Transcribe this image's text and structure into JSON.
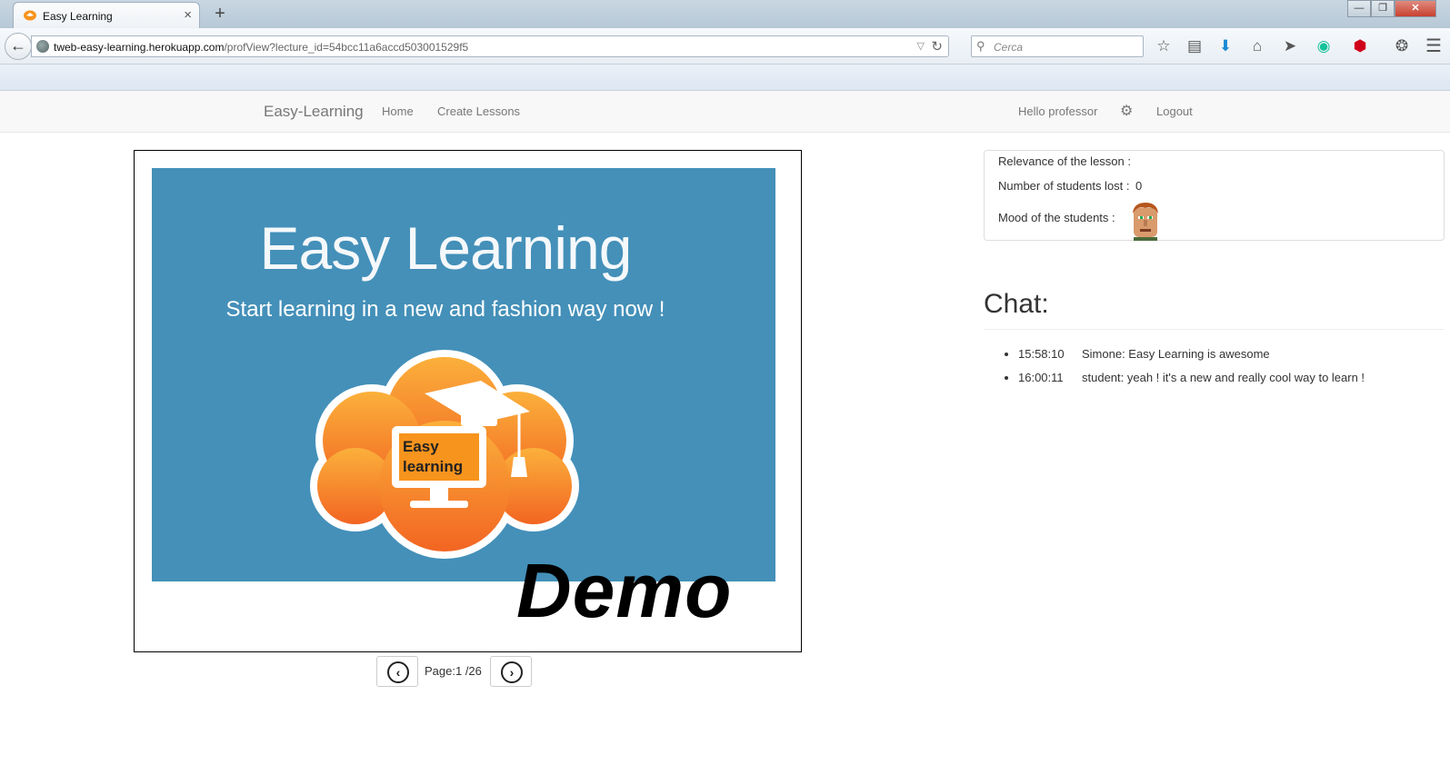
{
  "browser": {
    "tab_title": "Easy Learning",
    "tab_close": "×",
    "new_tab": "+",
    "url_host": "tweb-easy-learning.herokuapp.com",
    "url_path": "/profView?lecture_id=54bcc11a6accd503001529f5",
    "search_placeholder": "Cerca",
    "toolbar_icons": [
      "bookmark-star-icon",
      "reading-list-icon",
      "downloads-icon",
      "home-icon",
      "send-icon",
      "grammarly-icon",
      "adblock-icon",
      "extension-icon",
      "menu-icon"
    ]
  },
  "navbar": {
    "brand": "Easy-Learning",
    "links": [
      "Home",
      "Create Lessons"
    ],
    "greeting": "Hello professor",
    "logout": "Logout"
  },
  "slide": {
    "title": "Easy Learning",
    "subtitle": "Start learning in a new and fashion way now !",
    "logo_text_1": "Easy",
    "logo_text_2": "learning",
    "watermark": "Demo",
    "background_color": "#4490b9",
    "logo_color": "#f7941d"
  },
  "pager": {
    "label": "Page:1 /26",
    "current": 1,
    "total": 26
  },
  "stats": {
    "relevance_label": "Relevance of the lesson :",
    "lost_label": "Number of students lost :",
    "lost_value": "0",
    "mood_label": "Mood of the students :"
  },
  "chat": {
    "title": "Chat:",
    "messages": [
      {
        "time": "15:58:10",
        "text": "Simone: Easy Learning is awesome"
      },
      {
        "time": "16:00:11",
        "text": "student: yeah ! it's a new and really cool way to learn !"
      }
    ]
  }
}
